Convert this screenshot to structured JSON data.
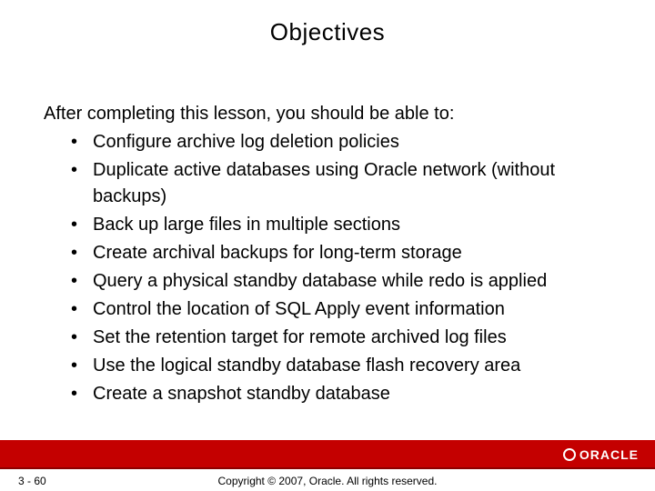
{
  "title": "Objectives",
  "intro": "After completing this lesson, you should be able to:",
  "bullets": [
    "Configure archive log deletion policies",
    "Duplicate active databases using Oracle network (without backups)",
    "Back up large files in multiple sections",
    "Create archival backups for long-term storage",
    "Query a physical standby database while redo is applied",
    "Control the location of SQL Apply event information",
    "Set the retention target for remote archived log files",
    "Use the logical standby database flash recovery area",
    "Create a snapshot standby database"
  ],
  "logo_text": "ORACLE",
  "page_number": "3 - 60",
  "copyright": "Copyright © 2007, Oracle. All rights reserved."
}
